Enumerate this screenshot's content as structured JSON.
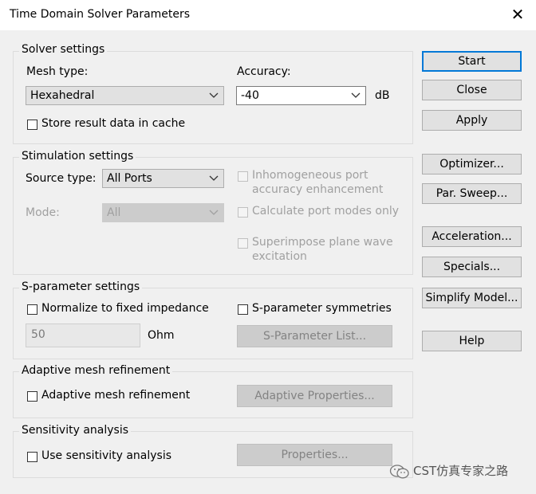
{
  "window": {
    "title": "Time Domain Solver Parameters",
    "close_glyph": "✕"
  },
  "solver": {
    "legend": "Solver settings",
    "mesh_label": "Mesh type:",
    "mesh_value": "Hexahedral",
    "accuracy_label": "Accuracy:",
    "accuracy_value": "-40",
    "accuracy_unit": "dB",
    "store_label": "Store result data in cache",
    "store_checked": false
  },
  "stimulation": {
    "legend": "Stimulation settings",
    "source_label": "Source type:",
    "source_value": "All Ports",
    "mode_label": "Mode:",
    "mode_value": "All",
    "inhomo_label_1": "Inhomogeneous port",
    "inhomo_label_2": "accuracy enhancement",
    "calc_modes_label": "Calculate port modes only",
    "superimpose_label_1": "Superimpose plane wave",
    "superimpose_label_2": "excitation"
  },
  "sparam": {
    "legend": "S-parameter settings",
    "normalize_label": "Normalize to fixed impedance",
    "symmetries_label": "S-parameter symmetries",
    "impedance_value": "50",
    "impedance_unit": "Ohm",
    "list_button": "S-Parameter List..."
  },
  "adaptive": {
    "legend": "Adaptive mesh refinement",
    "check_label": "Adaptive mesh refinement",
    "props_button": "Adaptive Properties..."
  },
  "sensitivity": {
    "legend": "Sensitivity analysis",
    "check_label": "Use sensitivity analysis",
    "props_button": "Properties..."
  },
  "buttons": {
    "start": "Start",
    "close": "Close",
    "apply": "Apply",
    "optimizer": "Optimizer...",
    "par_sweep": "Par. Sweep...",
    "acceleration": "Acceleration...",
    "specials": "Specials...",
    "simplify": "Simplify Model...",
    "help": "Help"
  },
  "watermark": {
    "text": "CST仿真专家之路",
    "icon": "wechat-icon"
  },
  "colors": {
    "default_button_border": "#0078d7",
    "dialog_bg": "#f0f0f0"
  }
}
